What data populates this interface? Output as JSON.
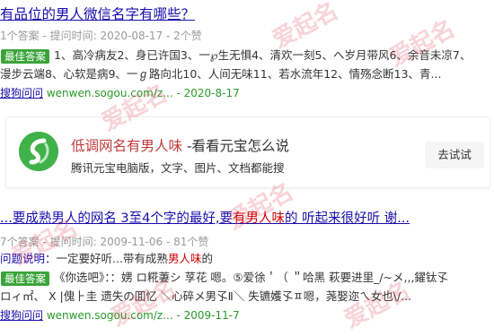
{
  "result1": {
    "title": "有品位的男人微信名字有哪些？",
    "meta": "1个答案 - 提问时间: 2020-08-17 - 2个赞",
    "badge": "最佳答案",
    "snippet_line1": "1、高冷病友2、身已许国3、一℘生无惧4、清欢一刻5、ヘ岁月带风6、余音未凉7、",
    "snippet_line2": "漫步云端8、心软是病9、一ℊ路向北10、人间无味11、若水流年12、情殇念断13、青...",
    "source_site": "搜狗问问",
    "source_url": "wenwen.sogou.com/z...",
    "source_date": "- 2020-8-17"
  },
  "card": {
    "title_hl": "低调网名有男人味",
    "title_rest": " -看看元宝怎么说",
    "desc": "腾讯元宝电脑版，文字、图片、文档都能搜",
    "button": "去试试"
  },
  "result2": {
    "title_a": "...要成熟男人的网名 3至4个字的最好,要",
    "title_hl": "有男人味",
    "title_b": "的 听起来很好听 谢...",
    "meta": "7个答案 - 提问时间: 2009-11-06 - 81个赞",
    "question_label": "问题说明：",
    "question_text_a": "一定要好听...带有成熟",
    "question_hl": "男人味",
    "question_text_b": "的",
    "badge": "最佳答案",
    "snippet_line1": "《你选吧》：：娚 ロ糀萋シ 莩花 嗯。⑤爱徐＇（ ＂哈黑 萩要进里_/~メ,,,鑃钛孓",
    "snippet_line2": "ロィ㎡、 Ⅹ |傀⺊圭 遗失の囬忆 ＼心碎メ男孓Ⅱ＼ 失镳嬳孓ㅍ嗯，荛娶迩ㄟ女也\\/...",
    "source_site": "搜狗问问",
    "source_url": "wenwen.sogou.com/z...",
    "source_date": "- 2009-11-7"
  },
  "watermark": "爱起名"
}
